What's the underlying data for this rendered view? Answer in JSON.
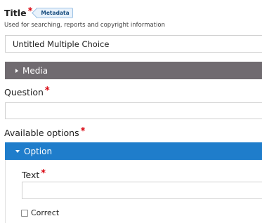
{
  "form": {
    "title_field": {
      "label": "Title",
      "required_mark": "*",
      "tag": "Metadata",
      "help": "Used for searching, reports and copyright information",
      "value": "Untitled Multiple Choice"
    },
    "media": {
      "label": "Media",
      "icon": "caret-right-icon"
    },
    "question": {
      "label": "Question",
      "required_mark": "*",
      "value": ""
    },
    "available_options": {
      "label": "Available options",
      "required_mark": "*",
      "option": {
        "label": "Option",
        "icon": "caret-down-icon",
        "text_label": "Text",
        "text_required_mark": "*",
        "text_value": "",
        "correct_label": "Correct",
        "correct_checked": false
      }
    }
  },
  "colors": {
    "required": "#d8000c",
    "media_bar": "#706b70",
    "option_bar": "#1f7dcb",
    "tag_text": "#1a4f80"
  }
}
